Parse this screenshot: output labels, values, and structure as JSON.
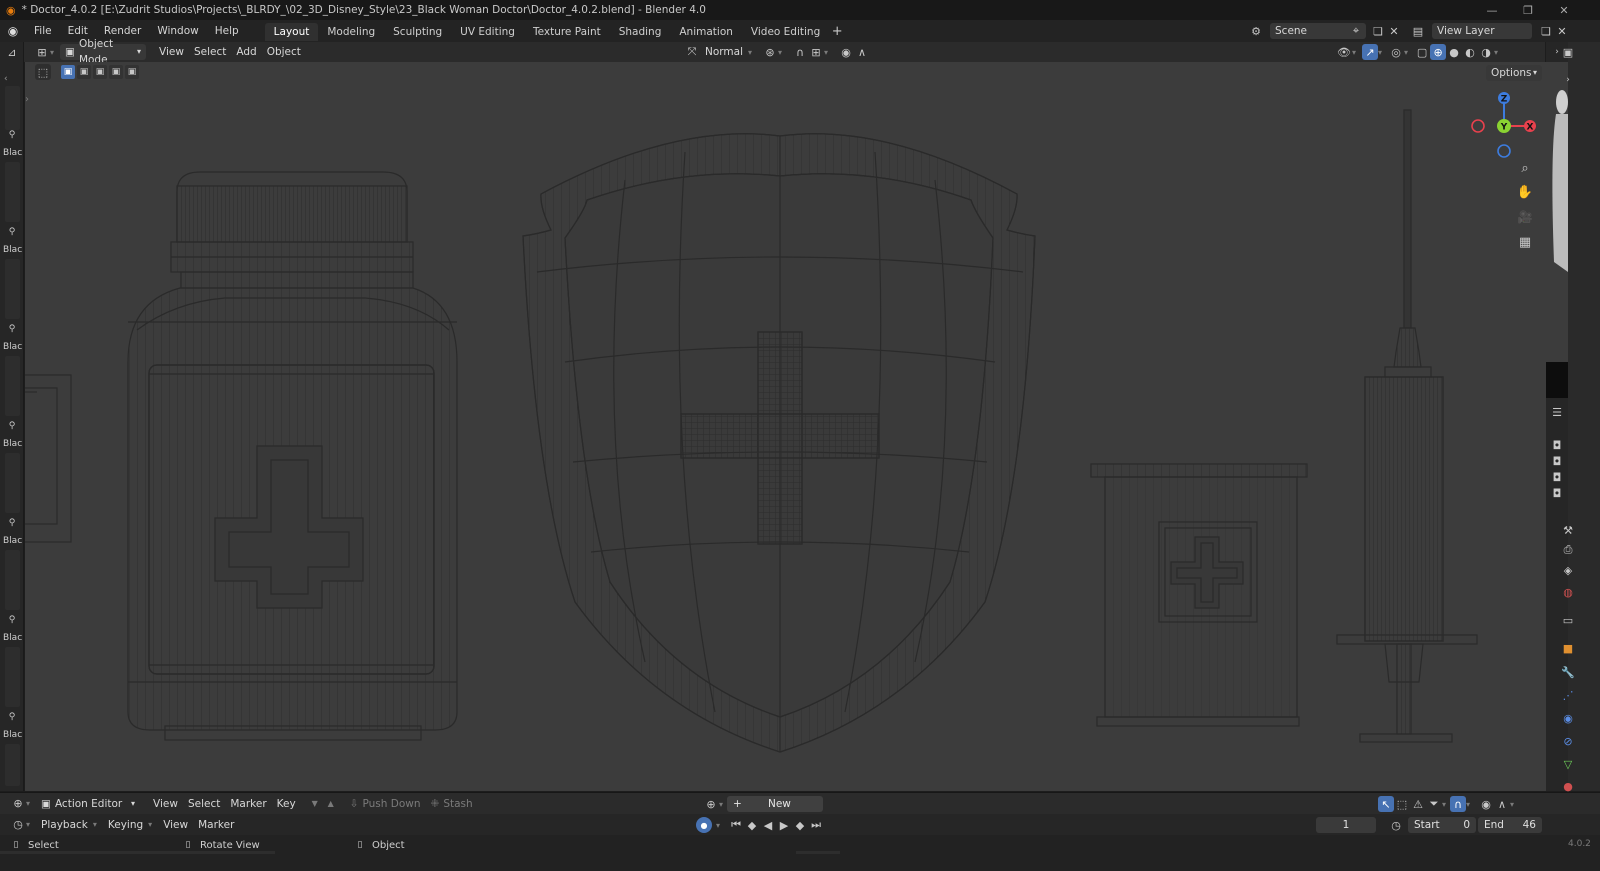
{
  "window": {
    "title": "* Doctor_4.0.2 [E:\\Zudrit Studios\\Projects\\_BLRDY_\\02_3D_Disney_Style\\23_Black Woman Doctor\\Doctor_4.0.2.blend] - Blender 4.0",
    "version": "4.0.2"
  },
  "menu": {
    "items": [
      "File",
      "Edit",
      "Render",
      "Window",
      "Help"
    ]
  },
  "workspaces": {
    "tabs": [
      "Layout",
      "Modeling",
      "Sculpting",
      "UV Editing",
      "Texture Paint",
      "Shading",
      "Animation",
      "Video Editing"
    ],
    "active": "Layout"
  },
  "scene": {
    "label": "Scene"
  },
  "view_layer": {
    "label": "View Layer"
  },
  "viewport_header": {
    "mode": "Object Mode",
    "menus": [
      "View",
      "Select",
      "Add",
      "Object"
    ],
    "orientation": "Normal",
    "options_label": "Options"
  },
  "left_toolbar": {
    "labels": [
      "Blac",
      "Blac",
      "Blac",
      "Blac",
      "Blac",
      "Blac",
      "Blac"
    ]
  },
  "timeline": {
    "editor": "Action Editor",
    "menus": [
      "View",
      "Select",
      "Marker",
      "Key"
    ],
    "push_down": "Push Down",
    "stash": "Stash",
    "new_label": "New"
  },
  "playback": {
    "menus": [
      "Playback",
      "Keying",
      "View",
      "Marker"
    ],
    "current_frame": "1",
    "start_label": "Start",
    "start_value": "0",
    "end_label": "End",
    "end_value": "46"
  },
  "status": {
    "select": "Select",
    "rotate": "Rotate View",
    "object": "Object"
  },
  "gizmo": {
    "z": "Z",
    "y": "Y",
    "x": "X"
  },
  "colors": {
    "viewport_bg": "#3c3c3c",
    "wire": "#2a2a2a",
    "axis_x": "#e8414d",
    "axis_y": "#8ad332",
    "axis_z": "#3d7cde",
    "accent": "#4772b3"
  }
}
